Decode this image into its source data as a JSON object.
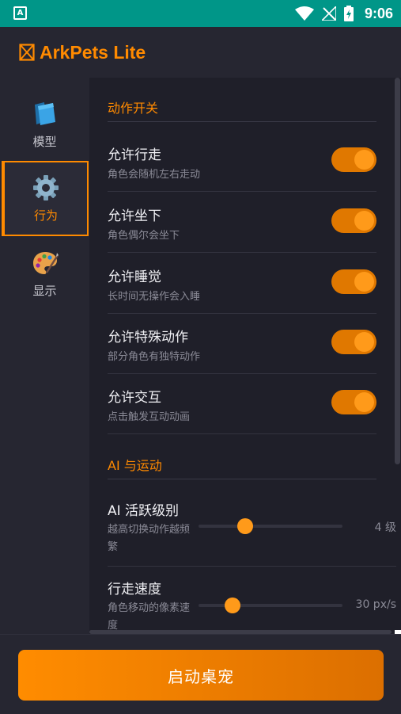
{
  "status_bar": {
    "notification_icon": "app-notification-icon",
    "time": "9:06",
    "icons": [
      "wifi-icon",
      "no-signal-icon",
      "battery-charging-icon"
    ]
  },
  "app_bar": {
    "logo_icon": "box-logo-icon",
    "title": "ArkPets Lite",
    "accent": "#ff8a00"
  },
  "sidebar": {
    "items": [
      {
        "icon": "folder-icon",
        "label": "模型",
        "active": false
      },
      {
        "icon": "gear-icon",
        "label": "行为",
        "active": true
      },
      {
        "icon": "palette-icon",
        "label": "显示",
        "active": false
      }
    ]
  },
  "behavior": {
    "section_title": "动作开关",
    "toggles": [
      {
        "title": "允许行走",
        "desc": "角色会随机左右走动",
        "on": true
      },
      {
        "title": "允许坐下",
        "desc": "角色偶尔会坐下",
        "on": true
      },
      {
        "title": "允许睡觉",
        "desc": "长时间无操作会入睡",
        "on": true
      },
      {
        "title": "允许特殊动作",
        "desc": "部分角色有独特动作",
        "on": true
      },
      {
        "title": "允许交互",
        "desc": "点击触发互动动画",
        "on": true
      }
    ]
  },
  "ai_motion": {
    "section_title": "AI 与运动",
    "sliders": [
      {
        "title": "AI 活跃级别",
        "desc": "越高切换动作越频繁",
        "value_text": "4 级",
        "fraction": 0.27
      },
      {
        "title": "行走速度",
        "desc": "角色移动的像素速度",
        "value_text": "30 px/s",
        "fraction": 0.18
      }
    ]
  },
  "footer": {
    "start_label": "启动桌宠"
  }
}
